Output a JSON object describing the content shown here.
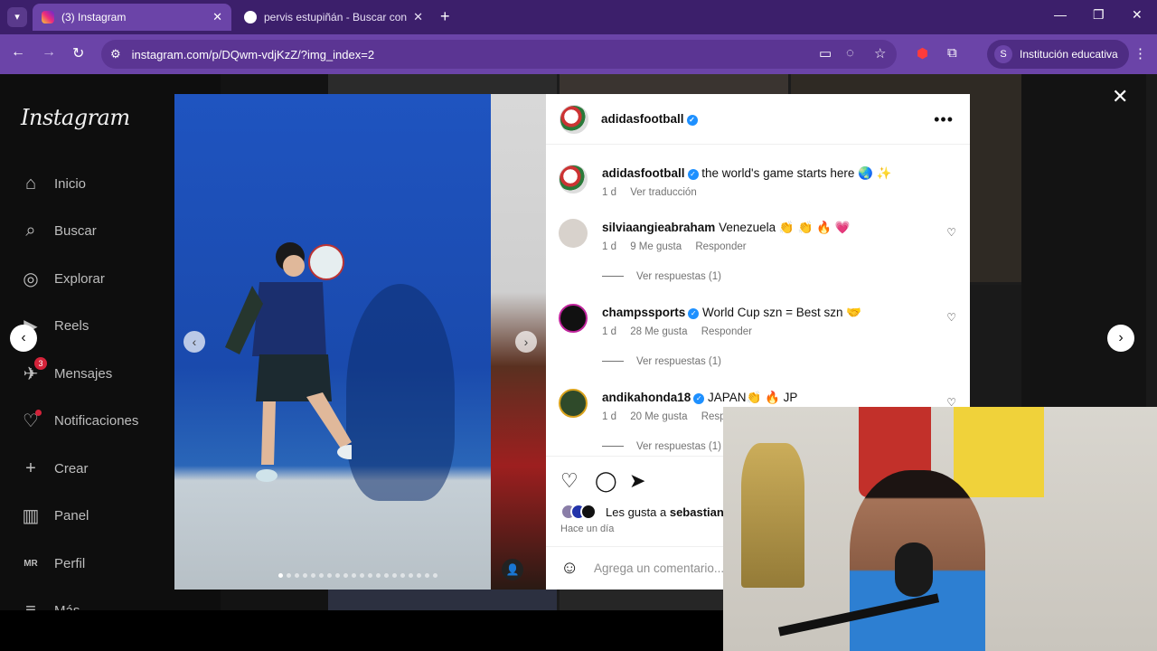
{
  "browser": {
    "tabs": [
      {
        "title": "(3) Instagram",
        "active": true
      },
      {
        "title": "pervis estupiñán - Buscar con G",
        "active": false
      }
    ],
    "url": "instagram.com/p/DQwm-vdjKzZ/?img_index=2",
    "profile_initial": "S",
    "profile_label": "Institución educativa"
  },
  "sidebar": {
    "logo": "Instagram",
    "items": [
      {
        "label": "Inicio",
        "icon": "home-icon"
      },
      {
        "label": "Buscar",
        "icon": "search-icon"
      },
      {
        "label": "Explorar",
        "icon": "compass-icon"
      },
      {
        "label": "Reels",
        "icon": "reels-icon"
      },
      {
        "label": "Mensajes",
        "icon": "messenger-icon",
        "badge": "3"
      },
      {
        "label": "Notificaciones",
        "icon": "heart-icon"
      },
      {
        "label": "Crear",
        "icon": "plus-icon"
      },
      {
        "label": "Panel",
        "icon": "chart-icon"
      },
      {
        "label": "Perfil",
        "icon": "profile-icon"
      },
      {
        "label": "Más",
        "icon": "menu-icon"
      }
    ]
  },
  "post": {
    "author": "adidasfootball",
    "caption": {
      "user": "adidasfootball",
      "text": "the world's game starts here 🌏 ✨",
      "time": "1 d",
      "translate": "Ver traducción"
    },
    "comments": [
      {
        "user": "silviaangieabraham",
        "verified": false,
        "text": "Venezuela 👏 👏 🔥 💗",
        "time": "1 d",
        "likes": "9 Me gusta",
        "reply": "Responder",
        "replies": "Ver respuestas (1)"
      },
      {
        "user": "champssports",
        "verified": true,
        "text": "World Cup szn = Best szn 🤝",
        "time": "1 d",
        "likes": "28 Me gusta",
        "reply": "Responder",
        "replies": "Ver respuestas (1)"
      },
      {
        "user": "andikahonda18",
        "verified": true,
        "text": "JAPAN👏 🔥 JP",
        "time": "1 d",
        "likes": "20 Me gusta",
        "reply": "Respo",
        "replies": "Ver respuestas (1)"
      }
    ],
    "likes_prefix": "Les gusta a ",
    "likes_user": "sebastianca",
    "posted": "Hace un día",
    "comment_placeholder": "Agrega un comentario..."
  }
}
